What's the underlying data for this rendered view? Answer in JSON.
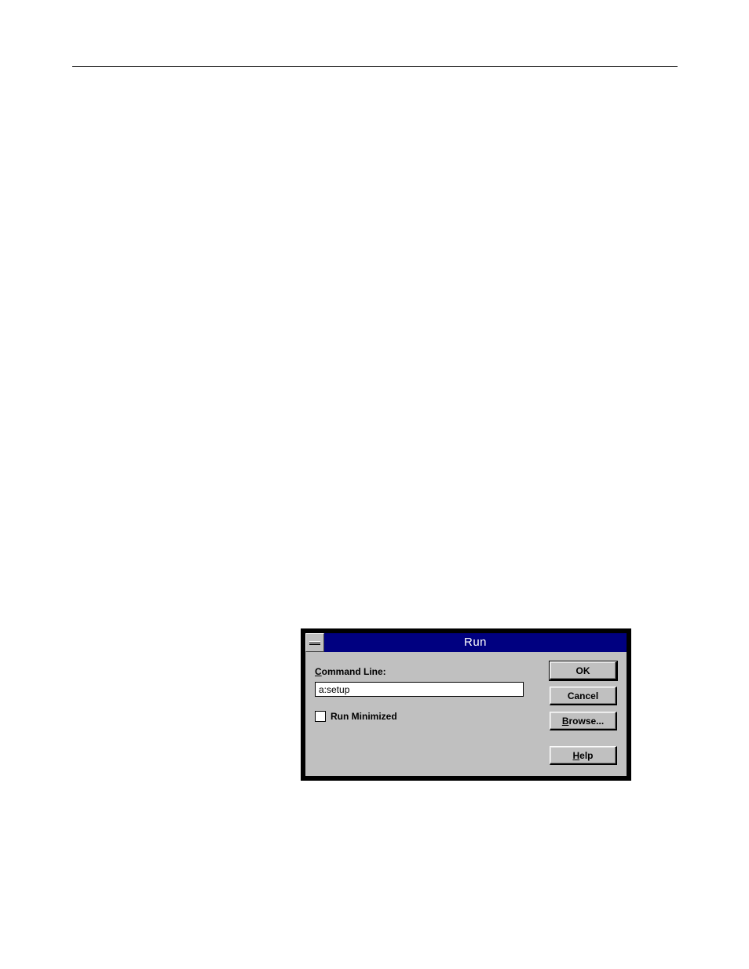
{
  "dialog": {
    "title": "Run",
    "command_label_pre": "C",
    "command_label_rest": "ommand Line:",
    "command_value": "a:setup",
    "minimized_label_pre": "Run ",
    "minimized_label_ul": "M",
    "minimized_label_post": "inimized",
    "buttons": {
      "ok": "OK",
      "cancel": "Cancel",
      "browse_ul": "B",
      "browse_rest": "rowse...",
      "help_ul": "H",
      "help_rest": "elp"
    }
  }
}
